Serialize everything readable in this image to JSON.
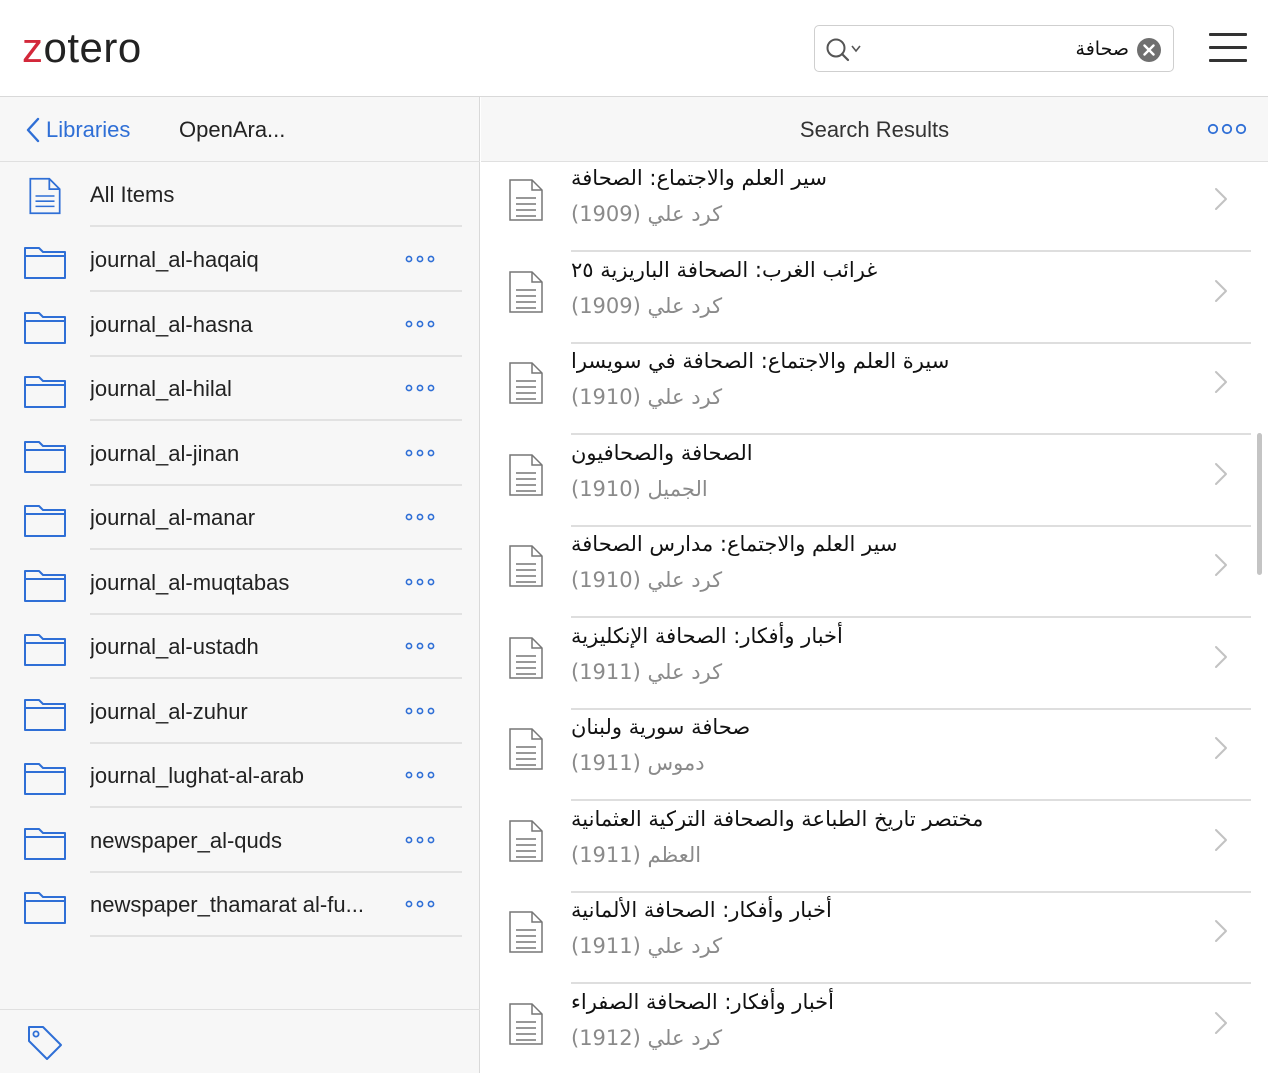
{
  "app": {
    "logo_text_first": "z",
    "logo_text_rest": "otero",
    "brand_color": "#d3283a",
    "accent_color": "#2f6fd6"
  },
  "search": {
    "value": "صحافة",
    "mode_icon": "search-icon",
    "clear_icon": "clear-icon"
  },
  "menu": {
    "icon": "hamburger-menu-icon"
  },
  "sidebar": {
    "back_label": "Libraries",
    "library_title": "OpenAra...",
    "all_items_label": "All Items",
    "collections": [
      {
        "label": "journal_al-haqaiq"
      },
      {
        "label": "journal_al-hasna"
      },
      {
        "label": "journal_al-hilal"
      },
      {
        "label": "journal_al-jinan"
      },
      {
        "label": "journal_al-manar"
      },
      {
        "label": "journal_al-muqtabas"
      },
      {
        "label": "journal_al-ustadh"
      },
      {
        "label": "journal_al-zuhur"
      },
      {
        "label": "journal_lughat-al-arab"
      },
      {
        "label": "newspaper_al-quds"
      },
      {
        "label": "newspaper_thamarat al-fu..."
      }
    ],
    "footer_icon": "tag-icon"
  },
  "results": {
    "title": "Search Results",
    "items": [
      {
        "title": "سير العلم والاجتماع: الصحافة",
        "year": "(1909)",
        "author": "كرد علي"
      },
      {
        "title": "غرائب الغرب: الصحافة الباريزية ٢٥",
        "year": "(1909)",
        "author": "كرد علي"
      },
      {
        "title": "سيرة العلم والاجتماع: الصحافة في سويسرا",
        "year": "(1910)",
        "author": "كرد علي"
      },
      {
        "title": "الصحافة والصحافيون",
        "year": "(1910)",
        "author": "الجميل"
      },
      {
        "title": "سير العلم والاجتماع: مدارس الصحافة",
        "year": "(1910)",
        "author": "كرد علي"
      },
      {
        "title": "أخبار وأفكار: الصحافة الإنكليزية",
        "year": "(1911)",
        "author": "كرد علي"
      },
      {
        "title": "صحافة سورية ولبنان",
        "year": "(1911)",
        "author": "دموس"
      },
      {
        "title": "مختصر تاريخ الطباعة والصحافة التركية العثمانية",
        "year": "(1911)",
        "author": "العظم"
      },
      {
        "title": "أخبار وأفكار: الصحافة الألمانية",
        "year": "(1911)",
        "author": "كرد علي"
      },
      {
        "title": "أخبار وأفكار: الصحافة الصفراء",
        "year": "(1912)",
        "author": "كرد علي"
      }
    ]
  }
}
